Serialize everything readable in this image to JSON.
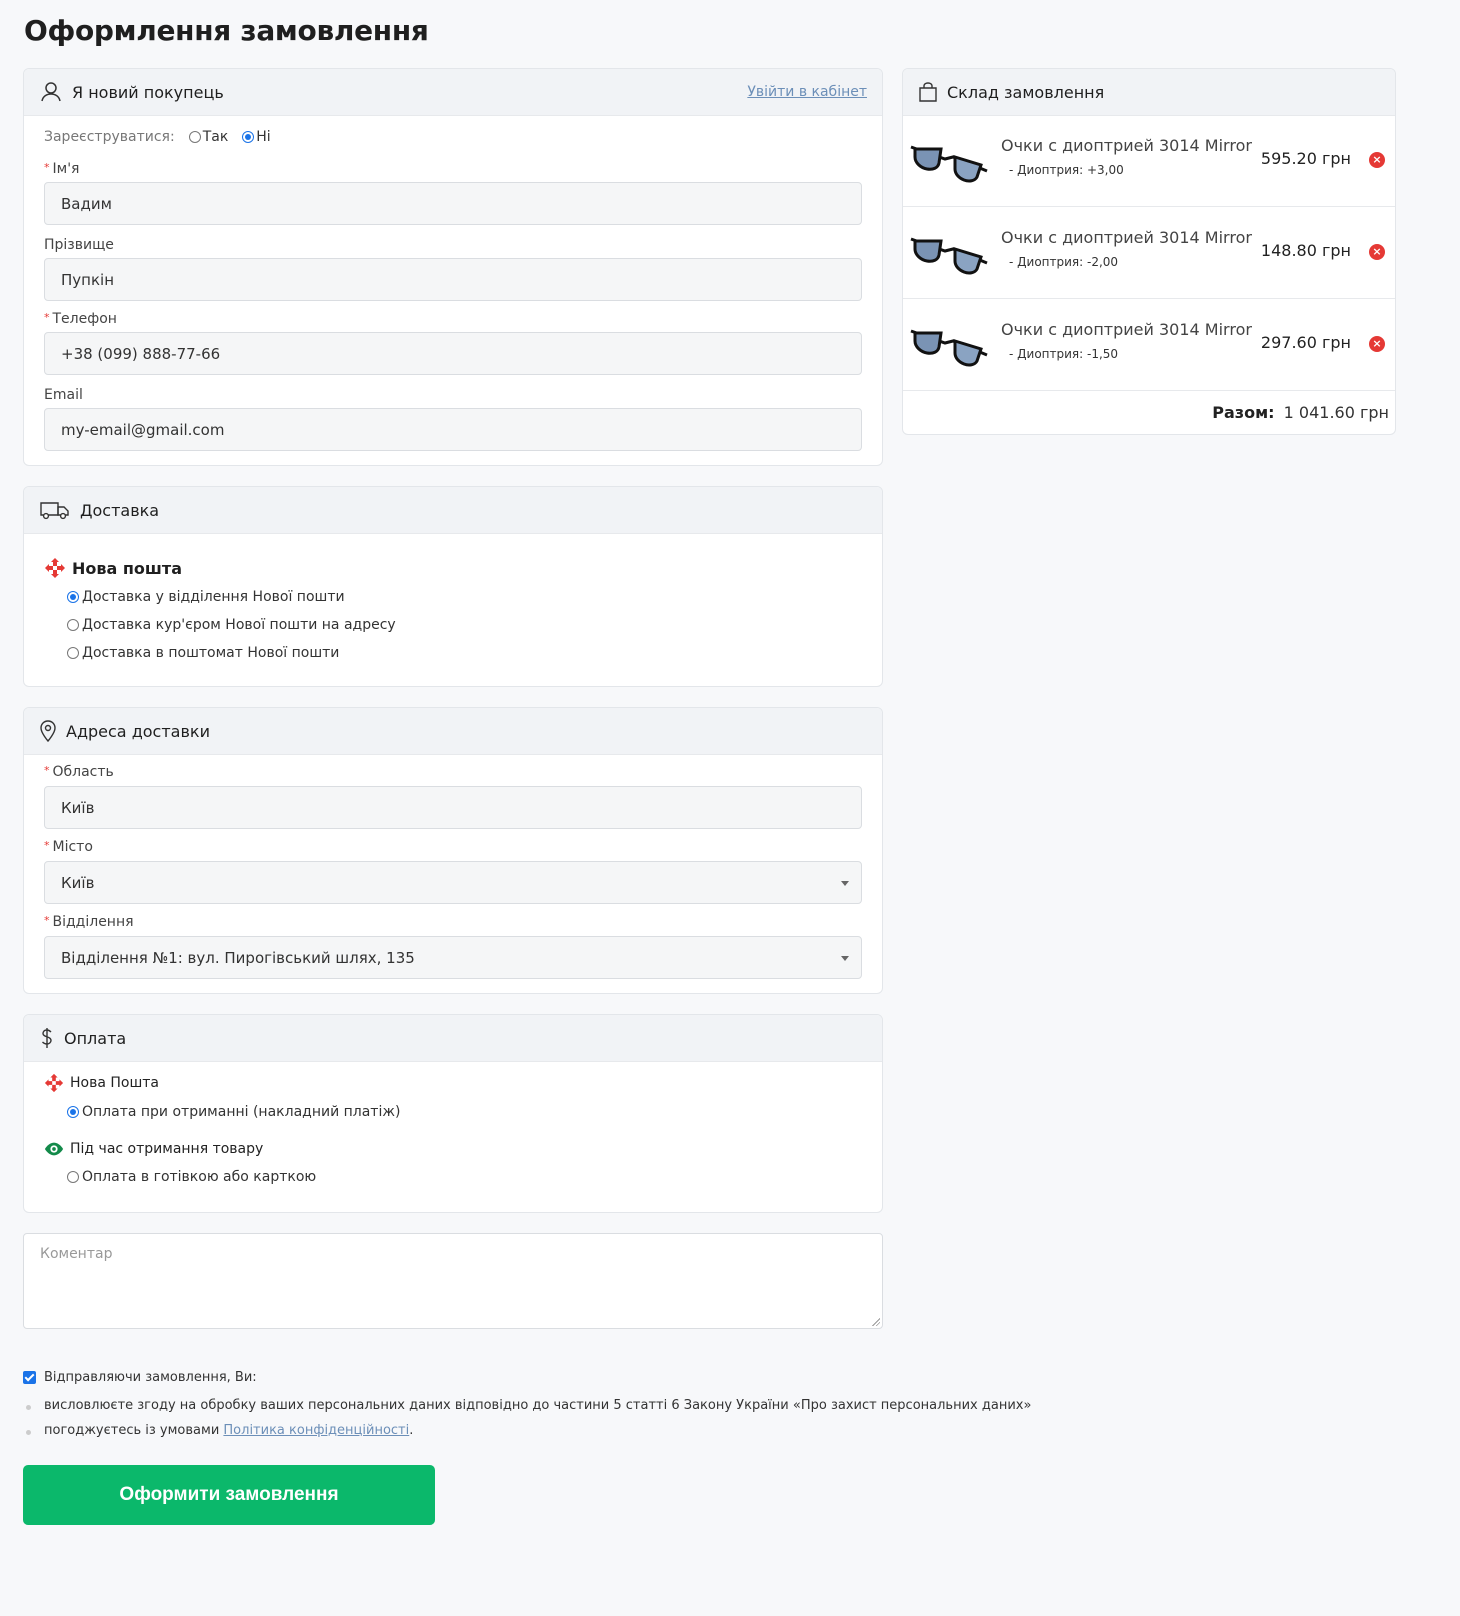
{
  "page": {
    "title": "Оформлення замовлення"
  },
  "customer": {
    "title": "Я новий покупець",
    "login_link": "Увійти в кабінет",
    "register_label": "Зареєструватися:",
    "register_yes": "Так",
    "register_no": "Ні",
    "register_selected": "Ні",
    "first_name_label": "Ім'я",
    "first_name_value": "Вадим",
    "last_name_label": "Прізвище",
    "last_name_value": "Пупкін",
    "phone_label": "Телефон",
    "phone_value": "+38 (099) 888-77-66",
    "email_label": "Email",
    "email_value": "my-email@gmail.com"
  },
  "delivery": {
    "title": "Доставка",
    "carrier": "Нова пошта",
    "options": [
      {
        "label": "Доставка у відділення Нової пошти",
        "selected": true
      },
      {
        "label": "Доставка кур'єром Нової пошти на адресу",
        "selected": false
      },
      {
        "label": "Доставка в поштомат Нової пошти",
        "selected": false
      }
    ]
  },
  "address": {
    "title": "Адреса доставки",
    "region_label": "Область",
    "region_value": "Київ",
    "city_label": "Місто",
    "city_value": "Київ",
    "branch_label": "Відділення",
    "branch_value": "Відділення №1: вул. Пирогівський шлях, 135"
  },
  "payment": {
    "title": "Оплата",
    "groups": [
      {
        "name": "Нова Пошта",
        "icon": "nova-poshta-icon",
        "option": "Оплата при отриманні (накладний платіж)",
        "selected": true
      },
      {
        "name": "Під час отримання товару",
        "icon": "eye-icon",
        "option": "Оплата в готівкою або карткою",
        "selected": false
      }
    ]
  },
  "comment": {
    "placeholder": "Коментар"
  },
  "consent": {
    "checked": true,
    "label": "Відправляючи замовлення, Ви:",
    "bullet1": "висловлюєте згоду на обробку ваших персональних даних відповідно до частини 5 статті 6 Закону України «Про захист персональних даних»",
    "bullet2_prefix": "погоджуєтесь із умовами ",
    "bullet2_link": "Політика конфіденційності",
    "bullet2_suffix": "."
  },
  "submit": {
    "label": "Оформити замовлення"
  },
  "cart": {
    "title": "Склад замовлення",
    "items": [
      {
        "name": "Очки с диоптрией 3014 Mirror",
        "option": "- Диоптрия: +3,00",
        "price": "595.20 грн"
      },
      {
        "name": "Очки с диоптрией 3014 Mirror",
        "option": "- Диоптрия: -2,00",
        "price": "148.80 грн"
      },
      {
        "name": "Очки с диоптрией 3014 Mirror",
        "option": "- Диоптрия: -1,50",
        "price": "297.60 грн"
      }
    ],
    "total_label": "Разом:",
    "total_value": "1 041.60 грн"
  },
  "colors": {
    "accent": "#0bb86b",
    "link": "#6c8fb8",
    "required": "#e53935",
    "radio": "#1a73e8"
  }
}
